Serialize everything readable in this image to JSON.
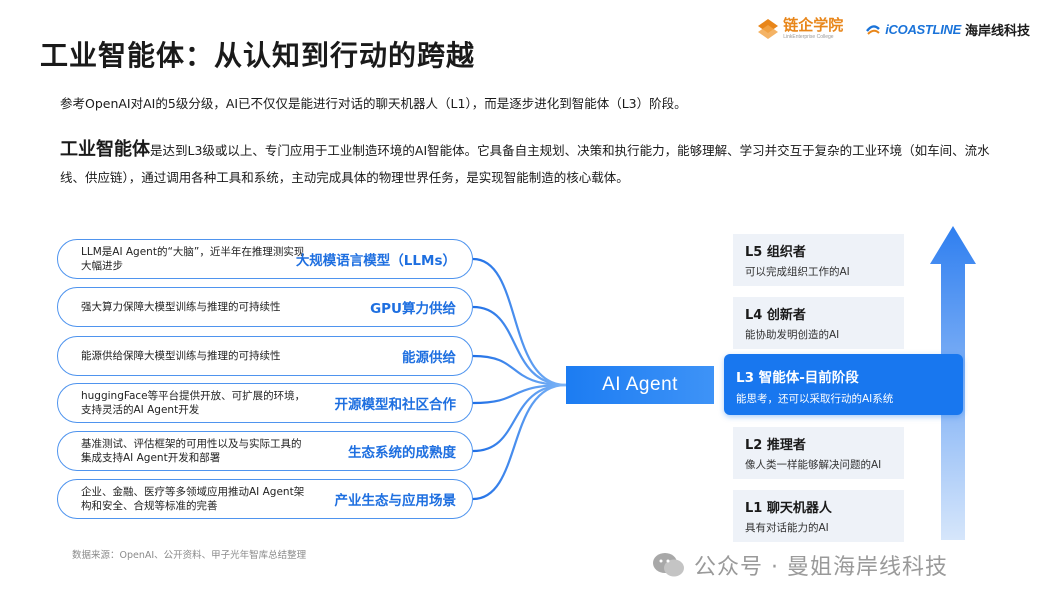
{
  "header": {
    "title": "工业智能体：从认知到行动的跨越",
    "logo_left_name": "链企学院",
    "logo_left_sub": "LinkEnterprise College",
    "logo_right_mark": "iCOASTLINE",
    "logo_right_name": "海岸线科技"
  },
  "intro": "参考OpenAI对AI的5级分级，AI已不仅仅是能进行对话的聊天机器人（L1），而是逐步进化到智能体（L3）阶段。",
  "definition": {
    "term": "工业智能体",
    "text": "是达到L3级或以上、专门应用于工业制造环境的AI智能体。它具备自主规划、决策和执行能力，能够理解、学习并交互于复杂的工业环境（如车间、流水线、供应链），通过调用各种工具和系统，主动完成具体的物理世界任务，是实现智能制造的核心载体。"
  },
  "drivers": [
    {
      "desc": "LLM是AI Agent的“大脑”，近半年在推理测实现大幅进步",
      "title": "大规模语言模型（LLMs）"
    },
    {
      "desc": "强大算力保障大模型训练与推理的可持续性",
      "title": "GPU算力供给"
    },
    {
      "desc": "能源供给保障大模型训练与推理的可持续性",
      "title": "能源供给"
    },
    {
      "desc": "huggingFace等平台提供开放、可扩展的环境，支持灵活的AI Agent开发",
      "title": "开源模型和社区合作"
    },
    {
      "desc": "基准测试、评估框架的可用性以及与实际工具的集成支持AI Agent开发和部署",
      "title": "生态系统的成熟度"
    },
    {
      "desc": "企业、金融、医疗等多领域应用推动AI Agent架构和安全、合规等标准的完善",
      "title": "产业生态与应用场景"
    }
  ],
  "agent_label": "AI  Agent",
  "levels": [
    {
      "title": "L5 组织者",
      "desc": "可以完成组织工作的AI"
    },
    {
      "title": "L4 创新者",
      "desc": "能协助发明创造的AI"
    },
    {
      "title": "L3 智能体-目前阶段",
      "desc": "能思考，还可以采取行动的AI系统"
    },
    {
      "title": "L2 推理者",
      "desc": "像人类一样能够解决问题的AI"
    },
    {
      "title": "L1  聊天机器人",
      "desc": "具有对话能力的AI"
    }
  ],
  "source": "数据来源：OpenAI、公开资料、甲子光年智库总结整理",
  "watermark": "公众号 · 曼姐海岸线科技",
  "colors": {
    "accent": "#1877ef",
    "connector": "#3d8bf0",
    "arrow_top": "#2f7ff0",
    "arrow_bottom": "#d6e6fb",
    "logo_orange": "#e8861a"
  },
  "icons": {
    "arrow": "up-arrow-icon",
    "watermark": "wechat-icon"
  }
}
